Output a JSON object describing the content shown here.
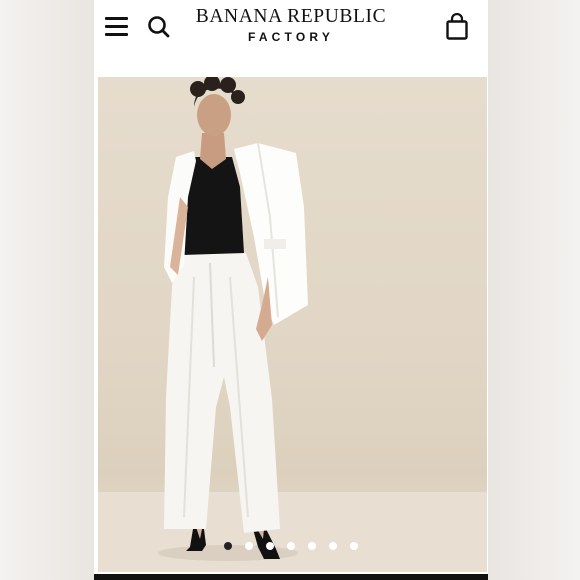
{
  "header": {
    "menu_icon": "hamburger-menu-icon",
    "search_icon": "search-icon",
    "bag_icon": "shopping-bag-icon",
    "logo": {
      "line1": "BANANA REPUBLIC",
      "line2": "FACTORY"
    }
  },
  "product_image": {
    "description_visible": false
  },
  "carousel": {
    "total": 7,
    "active_index": 1
  },
  "colors": {
    "background": "#ffffff",
    "photo_backdrop": "#e3d8c8",
    "text": "#111111"
  }
}
